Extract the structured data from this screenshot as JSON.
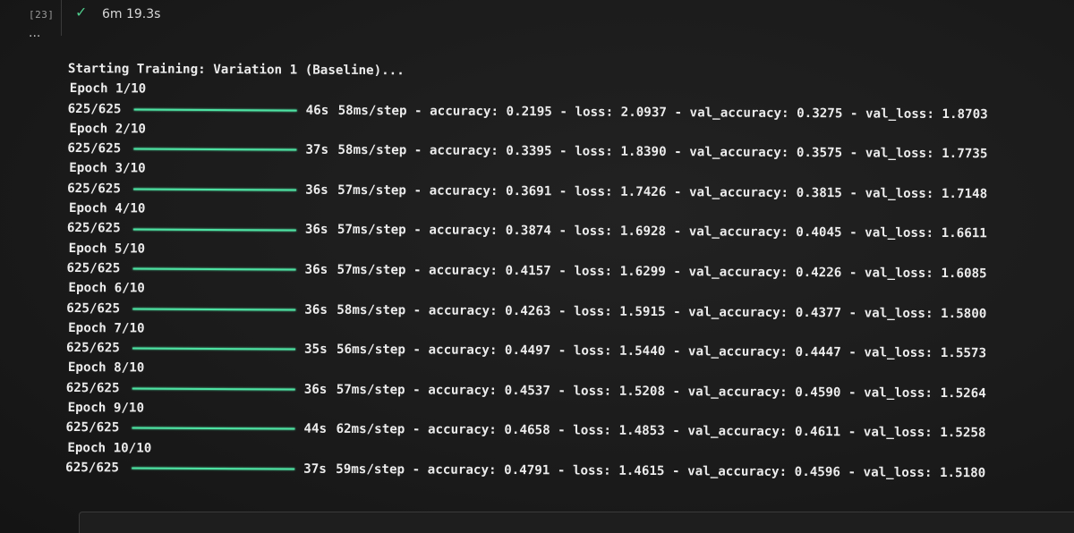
{
  "cell": {
    "execution_count": "[23]",
    "status_icon": "check-icon",
    "duration": "6m 19.3s",
    "more_icon": "ellipsis-icon"
  },
  "output": {
    "header": "Starting Training: Variation 1 (Baseline)...",
    "epochs": [
      {
        "epoch": "Epoch 1/10",
        "steps": "625/625",
        "time": "46s",
        "rest": "58ms/step - accuracy: 0.2195 - loss: 2.0937 - val_accuracy: 0.3275 - val_loss: 1.8703"
      },
      {
        "epoch": "Epoch 2/10",
        "steps": "625/625",
        "time": "37s",
        "rest": "58ms/step - accuracy: 0.3395 - loss: 1.8390 - val_accuracy: 0.3575 - val_loss: 1.7735"
      },
      {
        "epoch": "Epoch 3/10",
        "steps": "625/625",
        "time": "36s",
        "rest": "57ms/step - accuracy: 0.3691 - loss: 1.7426 - val_accuracy: 0.3815 - val_loss: 1.7148"
      },
      {
        "epoch": "Epoch 4/10",
        "steps": "625/625",
        "time": "36s",
        "rest": "57ms/step - accuracy: 0.3874 - loss: 1.6928 - val_accuracy: 0.4045 - val_loss: 1.6611"
      },
      {
        "epoch": "Epoch 5/10",
        "steps": "625/625",
        "time": "36s",
        "rest": "57ms/step - accuracy: 0.4157 - loss: 1.6299 - val_accuracy: 0.4226 - val_loss: 1.6085"
      },
      {
        "epoch": "Epoch 6/10",
        "steps": "625/625",
        "time": "36s",
        "rest": "58ms/step - accuracy: 0.4263 - loss: 1.5915 - val_accuracy: 0.4377 - val_loss: 1.5800"
      },
      {
        "epoch": "Epoch 7/10",
        "steps": "625/625",
        "time": "35s",
        "rest": "56ms/step - accuracy: 0.4497 - loss: 1.5440 - val_accuracy: 0.4447 - val_loss: 1.5573"
      },
      {
        "epoch": "Epoch 8/10",
        "steps": "625/625",
        "time": "36s",
        "rest": "57ms/step - accuracy: 0.4537 - loss: 1.5208 - val_accuracy: 0.4590 - val_loss: 1.5264"
      },
      {
        "epoch": "Epoch 9/10",
        "steps": "625/625",
        "time": "44s",
        "rest": "62ms/step - accuracy: 0.4658 - loss: 1.4853 - val_accuracy: 0.4611 - val_loss: 1.5258"
      },
      {
        "epoch": "Epoch 10/10",
        "steps": "625/625",
        "time": "37s",
        "rest": "59ms/step - accuracy: 0.4791 - loss: 1.4615 - val_accuracy: 0.4596 - val_loss: 1.5180"
      }
    ]
  },
  "colors": {
    "progress_bar": "#4ee3a3",
    "check": "#4ec98a",
    "background": "#1b1b1b"
  }
}
